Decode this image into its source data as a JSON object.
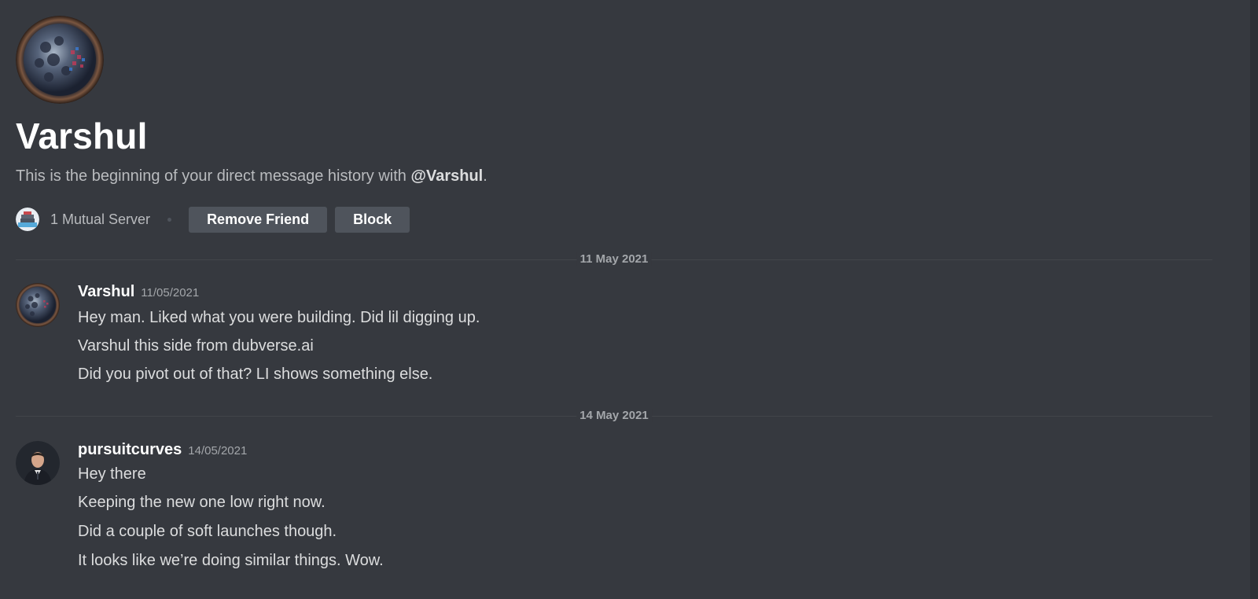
{
  "channel": {
    "title": "Varshul",
    "intro_prefix": "This is the beginning of your direct message history with ",
    "intro_mention": "@Varshul",
    "intro_suffix": ".",
    "mutual_servers": "1 Mutual Server",
    "remove_friend_label": "Remove Friend",
    "block_label": "Block"
  },
  "dividers": [
    {
      "label": "11 May 2021"
    },
    {
      "label": "14 May 2021"
    }
  ],
  "messages": [
    {
      "author": "Varshul",
      "timestamp": "11/05/2021",
      "lines": [
        "Hey man. Liked what you were building. Did lil digging up.",
        "Varshul this side from dubverse.ai",
        "Did you pivot out of that? LI shows something else."
      ]
    },
    {
      "author": "pursuitcurves",
      "timestamp": "14/05/2021",
      "lines": [
        "Hey there",
        "Keeping the new one low right now.",
        "Did a couple of soft launches though.",
        "It looks like we’re doing similar things. Wow."
      ]
    }
  ],
  "icons": {
    "profile_avatar": "planet-avatar-icon",
    "server": "cruise-ship-server-icon",
    "user_avatar": "person-in-suit-avatar-icon"
  },
  "colors": {
    "background": "#36393f",
    "button": "#4f545c",
    "text_primary": "#ffffff",
    "text_muted": "#b9bbbe",
    "divider": "#42454a"
  }
}
